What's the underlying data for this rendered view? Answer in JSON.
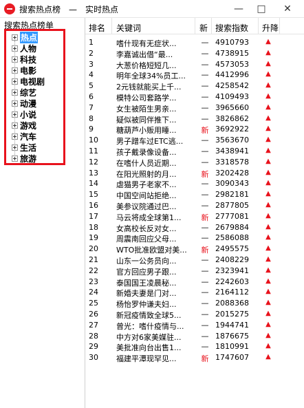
{
  "window": {
    "title": "搜索热点榜　—　实时热点",
    "minimize": "—",
    "maximize": "□",
    "close": "✕"
  },
  "sidebar": {
    "title": "搜索热点榜单",
    "items": [
      {
        "label": "热点",
        "selected": true
      },
      {
        "label": "人物"
      },
      {
        "label": "科技"
      },
      {
        "label": "电影"
      },
      {
        "label": "电视剧"
      },
      {
        "label": "综艺"
      },
      {
        "label": "动漫"
      },
      {
        "label": "小说"
      },
      {
        "label": "游戏"
      },
      {
        "label": "汽车"
      },
      {
        "label": "生活"
      },
      {
        "label": "旅游"
      }
    ]
  },
  "table": {
    "headers": {
      "rank": "排名",
      "keyword": "关键词",
      "new": "新",
      "index": "搜索指数",
      "trend": "升降"
    },
    "rows": [
      {
        "rank": "1",
        "keyword": "嗜什现有无症状...",
        "new": "—",
        "index": "4910793",
        "trend": "▲"
      },
      {
        "rank": "2",
        "keyword": "李嘉诚出借“最...",
        "new": "—",
        "index": "4738915",
        "trend": "▲"
      },
      {
        "rank": "3",
        "keyword": "大葱价格短短几...",
        "new": "—",
        "index": "4573053",
        "trend": "▲"
      },
      {
        "rank": "4",
        "keyword": "明年全球34%员工...",
        "new": "—",
        "index": "4412996",
        "trend": "▲"
      },
      {
        "rank": "5",
        "keyword": "2元钱就能买上千...",
        "new": "—",
        "index": "4258542",
        "trend": "▲"
      },
      {
        "rank": "6",
        "keyword": "模特公司套路学...",
        "new": "—",
        "index": "4109493",
        "trend": "▲"
      },
      {
        "rank": "7",
        "keyword": "女生被陌生男亲...",
        "new": "—",
        "index": "3965660",
        "trend": "▲"
      },
      {
        "rank": "8",
        "keyword": "疑似被同伴推下...",
        "new": "—",
        "index": "3826862",
        "trend": "▲"
      },
      {
        "rank": "9",
        "keyword": "糖葫芦小贩用睡...",
        "new": "新",
        "index": "3692922",
        "trend": "▲"
      },
      {
        "rank": "10",
        "keyword": "男子蹭车过ETC逃...",
        "new": "—",
        "index": "3563670",
        "trend": "▲"
      },
      {
        "rank": "11",
        "keyword": "孩子戴录像设备...",
        "new": "—",
        "index": "3438941",
        "trend": "▲"
      },
      {
        "rank": "12",
        "keyword": "在嗜什人员近期...",
        "new": "—",
        "index": "3318578",
        "trend": "▲"
      },
      {
        "rank": "13",
        "keyword": "在阳光照射的月...",
        "new": "新",
        "index": "3202428",
        "trend": "▲"
      },
      {
        "rank": "14",
        "keyword": "虐猫男子老家不...",
        "new": "—",
        "index": "3090343",
        "trend": "▲"
      },
      {
        "rank": "15",
        "keyword": "中国空间站拒绝...",
        "new": "—",
        "index": "2982181",
        "trend": "▲"
      },
      {
        "rank": "16",
        "keyword": "美参议院通过巴...",
        "new": "—",
        "index": "2877805",
        "trend": "▲"
      },
      {
        "rank": "17",
        "keyword": "马云将成全球第1...",
        "new": "新",
        "index": "2777081",
        "trend": "▲"
      },
      {
        "rank": "18",
        "keyword": "女高校长反对女...",
        "new": "—",
        "index": "2679884",
        "trend": "▲"
      },
      {
        "rank": "19",
        "keyword": "周震南回应父母...",
        "new": "—",
        "index": "2586088",
        "trend": "▲"
      },
      {
        "rank": "20",
        "keyword": "WTO批准欧盟对美...",
        "new": "新",
        "index": "2495575",
        "trend": "▲"
      },
      {
        "rank": "21",
        "keyword": "山东一公务员向...",
        "new": "—",
        "index": "2408229",
        "trend": "▲"
      },
      {
        "rank": "22",
        "keyword": "官方回应男子跟...",
        "new": "—",
        "index": "2323941",
        "trend": "▲"
      },
      {
        "rank": "23",
        "keyword": "泰国国王凌晨秘...",
        "new": "—",
        "index": "2242603",
        "trend": "▲"
      },
      {
        "rank": "24",
        "keyword": "新婚夫妻是门对...",
        "new": "—",
        "index": "2164112",
        "trend": "▲"
      },
      {
        "rank": "25",
        "keyword": "杨怡罗仲谦夫妇...",
        "new": "—",
        "index": "2088368",
        "trend": "▲"
      },
      {
        "rank": "26",
        "keyword": "新冠疫情致全球5...",
        "new": "—",
        "index": "2015275",
        "trend": "▲"
      },
      {
        "rank": "27",
        "keyword": "曾光：嗜什疫情与...",
        "new": "—",
        "index": "1944741",
        "trend": "▲"
      },
      {
        "rank": "28",
        "keyword": "中方对6家美媒驻...",
        "new": "—",
        "index": "1876675",
        "trend": "▲"
      },
      {
        "rank": "29",
        "keyword": "美批准向台出售1...",
        "new": "—",
        "index": "1810991",
        "trend": "▲"
      },
      {
        "rank": "30",
        "keyword": "福建平潭现罕见...",
        "new": "新",
        "index": "1747607",
        "trend": "▲"
      }
    ]
  },
  "colors": {
    "accent_red": "#e8121c",
    "selection_blue": "#3399ff"
  }
}
